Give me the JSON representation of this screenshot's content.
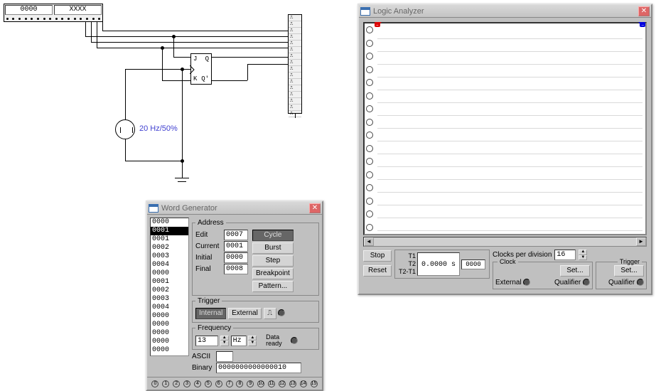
{
  "circuit": {
    "header_left": "0000",
    "header_right": "XXXX",
    "ic": {
      "j": "J",
      "k": "K",
      "q": "Q",
      "qn": "Q'"
    },
    "clock_label": "20 Hz/50%"
  },
  "word_generator": {
    "title": "Word Generator",
    "list": [
      "0000",
      "0001",
      "0001",
      "0002",
      "0003",
      "0004",
      "0000",
      "0001",
      "0002",
      "0003",
      "0004",
      "0000",
      "0000",
      "0000",
      "0000",
      "0000"
    ],
    "selected_index": 1,
    "address_legend": "Address",
    "address": {
      "edit_label": "Edit",
      "edit": "0007",
      "current_label": "Current",
      "current": "0001",
      "initial_label": "Initial",
      "initial": "0000",
      "final_label": "Final",
      "final": "0008"
    },
    "buttons": {
      "cycle": "Cycle",
      "burst": "Burst",
      "step": "Step",
      "breakpoint": "Breakpoint",
      "pattern": "Pattern..."
    },
    "trigger_legend": "Trigger",
    "trigger": {
      "internal": "Internal",
      "external": "External"
    },
    "frequency_legend": "Frequency",
    "frequency": {
      "value": "13",
      "unit": "Hz",
      "data_ready": "Data\nready"
    },
    "ascii_label": "ASCII",
    "ascii_value": "",
    "binary_label": "Binary",
    "binary_value": "0000000000000010",
    "pin_labels": [
      "0",
      "1",
      "2",
      "3",
      "4",
      "5",
      "6",
      "7",
      "8",
      "9",
      "10",
      "11",
      "12",
      "13",
      "14",
      "15"
    ]
  },
  "logic_analyzer": {
    "title": "Logic Analyzer",
    "channels": 16,
    "stop": "Stop",
    "reset": "Reset",
    "time_labels": {
      "t1": "T1",
      "t2": "T2",
      "dt": "T2-T1"
    },
    "time_readout": "0.0000 s",
    "time_box": "0000",
    "clocks_per_div_label": "Clocks per division",
    "clocks_per_div": "16",
    "clock_legend": "Clock",
    "trigger_legend": "Trigger",
    "set": "Set...",
    "external_label": "External",
    "qualifier_label": "Qualifier"
  }
}
